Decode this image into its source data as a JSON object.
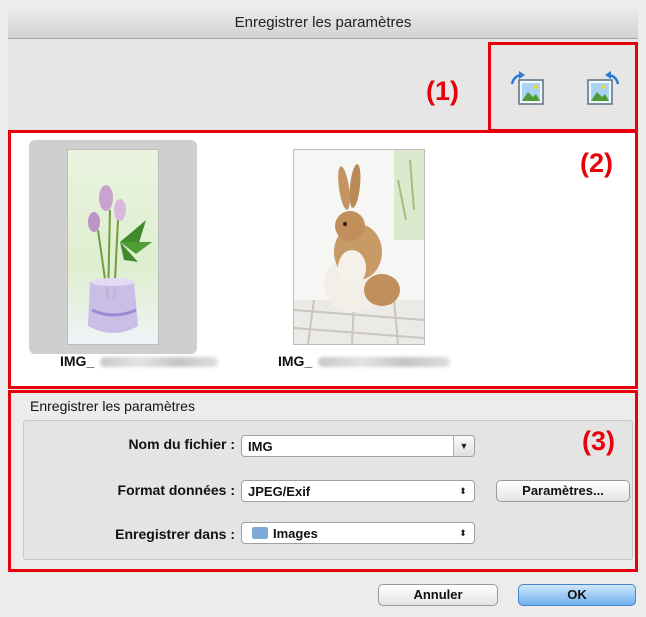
{
  "dialog": {
    "title": "Enregistrer les paramètres"
  },
  "callouts": {
    "one": "(1)",
    "two": "(2)",
    "three": "(3)"
  },
  "toolbar": {
    "buttons": [
      {
        "icon": "rotate-left-icon"
      },
      {
        "icon": "rotate-right-icon"
      }
    ]
  },
  "thumbnails": [
    {
      "label": "IMG_",
      "selected": true,
      "subject": "flowers in glass vase"
    },
    {
      "label": "IMG_",
      "selected": false,
      "subject": "rabbit on white chair"
    }
  ],
  "settings": {
    "group_title": "Enregistrer les paramètres",
    "filename_label": "Nom du fichier :",
    "filename_value": "IMG",
    "format_label": "Format données :",
    "format_value": "JPEG/Exif",
    "settings_button": "Paramètres...",
    "savein_label": "Enregistrer dans :",
    "savein_value": "Images"
  },
  "footer": {
    "cancel": "Annuler",
    "ok": "OK"
  },
  "colors": {
    "callout_red": "#e8000b",
    "default_button": "#6fb0ee"
  }
}
